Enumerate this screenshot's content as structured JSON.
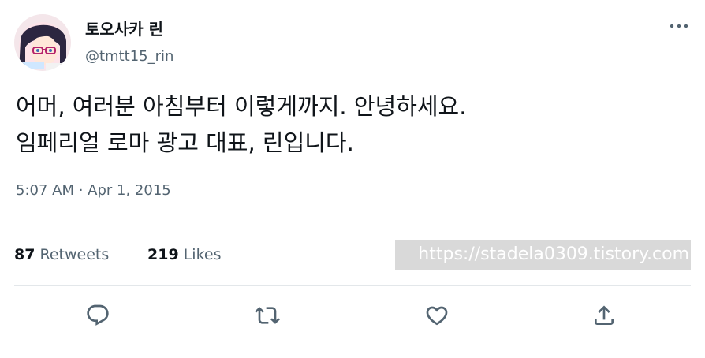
{
  "author": {
    "display_name": "토오사카 린",
    "handle": "@tmtt15_rin"
  },
  "tweet": {
    "lines": [
      "어머, 여러분 아침부터 이렇게까지. 안녕하세요.",
      "임페리얼 로마 광고 대표, 린입니다."
    ],
    "timestamp": "5:07 AM · Apr 1, 2015"
  },
  "stats": {
    "retweets_count": "87",
    "retweets_label": "Retweets",
    "likes_count": "219",
    "likes_label": "Likes"
  },
  "watermark": "https://stadela0309.tistory.com",
  "icons": {
    "more": "more-icon",
    "reply": "reply-icon",
    "retweet": "retweet-icon",
    "like": "like-icon",
    "share": "share-icon"
  },
  "colors": {
    "text_primary": "#0f1419",
    "text_secondary": "#536471",
    "divider": "#e3e7ea",
    "watermark_bg": "#d9d9d9"
  }
}
